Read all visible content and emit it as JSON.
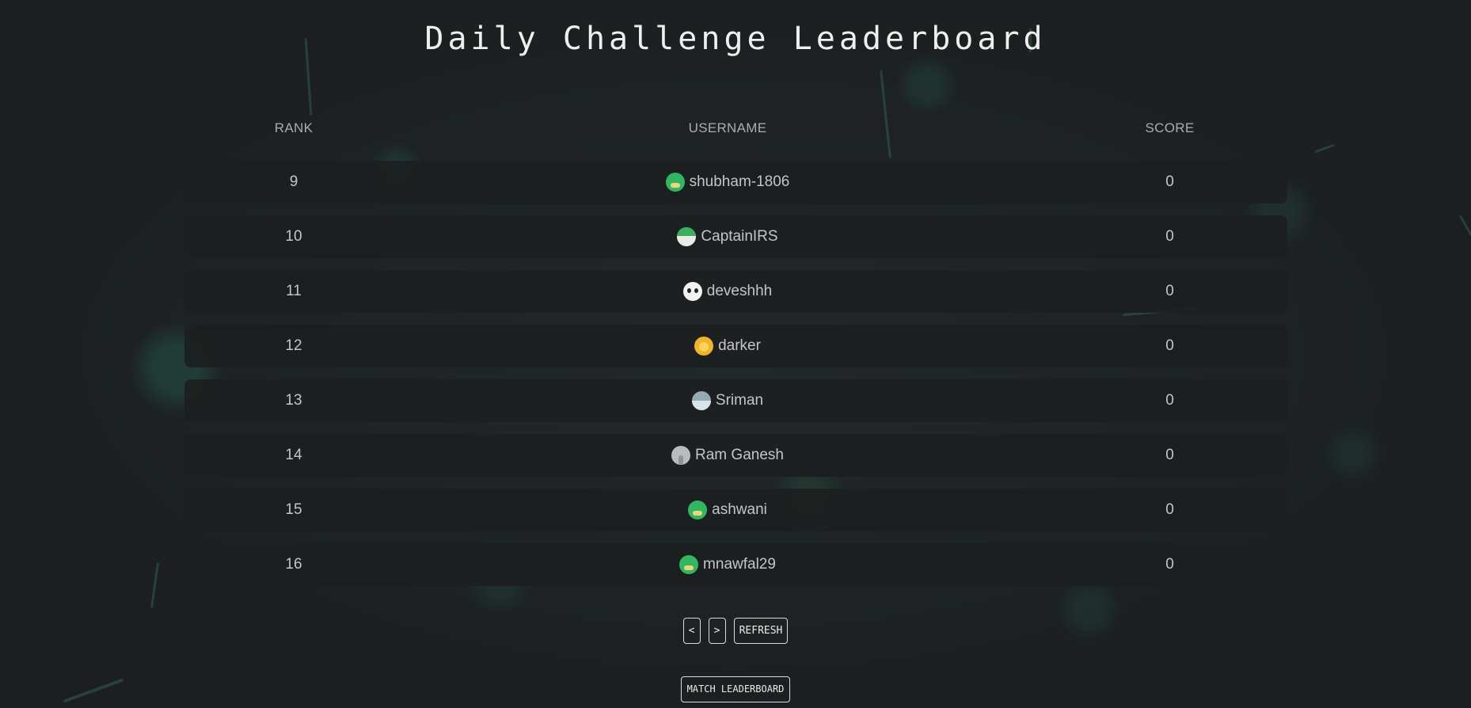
{
  "page": {
    "title": "Daily Challenge Leaderboard"
  },
  "table": {
    "headers": {
      "rank": "RANK",
      "username": "USERNAME",
      "score": "SCORE"
    },
    "rows": [
      {
        "rank": "9",
        "username": "shubham-1806",
        "score": "0",
        "avatar": "green-bird-icon"
      },
      {
        "rank": "10",
        "username": "CaptainIRS",
        "score": "0",
        "avatar": "frog-icon"
      },
      {
        "rank": "11",
        "username": "deveshhh",
        "score": "0",
        "avatar": "panda-icon"
      },
      {
        "rank": "12",
        "username": "darker",
        "score": "0",
        "avatar": "lion-icon"
      },
      {
        "rank": "13",
        "username": "Sriman",
        "score": "0",
        "avatar": "fish-icon"
      },
      {
        "rank": "14",
        "username": "Ram Ganesh",
        "score": "0",
        "avatar": "elephant-icon"
      },
      {
        "rank": "15",
        "username": "ashwani",
        "score": "0",
        "avatar": "green-bird-icon"
      },
      {
        "rank": "16",
        "username": "mnawfal29",
        "score": "0",
        "avatar": "green-bird-icon"
      }
    ]
  },
  "pagination": {
    "prev_label": "<",
    "next_label": ">",
    "refresh_label": "REFRESH"
  },
  "match_leaderboard_label": "MATCH LEADERBOARD",
  "colors": {
    "background": "#1d2122",
    "row_background": "#1c1f20",
    "accent_glow": "#2a7a62",
    "text": "#c3c6c7",
    "title": "#eef0f0"
  }
}
